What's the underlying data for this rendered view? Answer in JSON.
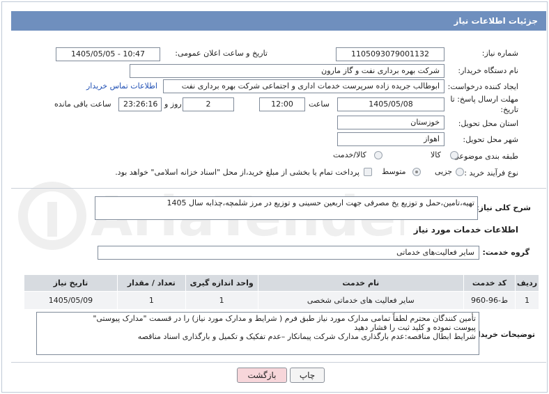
{
  "header": {
    "title": "جزئیات اطلاعات نیاز"
  },
  "fields": {
    "need_number_label": "شماره نیاز:",
    "need_number": "1105093079001132",
    "announce_label": "تاریخ و ساعت اعلان عمومی:",
    "announce_value": "1405/05/05 - 10:47",
    "buyer_org_label": "نام دستگاه خریدار:",
    "buyer_org": "شرکت بهره برداری نفت و گاز مارون",
    "creator_label": "ایجاد کننده درخواست:",
    "creator": "ابوطالب جریده زاده سرپرست خدمات اداری و اجتماعی شرکت بهره برداری نفت",
    "contact_link": "اطلاعات تماس خریدار",
    "deadline_label_1": "مهلت ارسال پاسخ: تا",
    "deadline_label_2": "تاریخ:",
    "deadline_date": "1405/05/08",
    "time_label": "ساعت",
    "deadline_time": "12:00",
    "days_value": "2",
    "days_label": "روز و",
    "remaining_time": "23:26:16",
    "remaining_label": "ساعت باقی مانده",
    "province_label": "استان محل تحویل:",
    "province": "خوزستان",
    "city_label": "شهر محل تحویل:",
    "city": "اهواز",
    "category_label": "طبقه بندی موضوعی:",
    "category_options": [
      "کالا",
      "کالا/خدمت"
    ],
    "process_label": "نوع فرآیند خرید :",
    "process_options": [
      "جزیی",
      "متوسط"
    ],
    "payment_note": "پرداخت تمام یا بخشی از مبلغ خرید،از محل \"اسناد خزانه اسلامی\" خواهد بود."
  },
  "description": {
    "label": "شرح کلی نیاز:",
    "text": "تهیه،تامین،حمل و توزیع یخ مصرفی جهت اربعین حسینی و توزیع در مرز شلمچه،چذابه  سال 1405"
  },
  "services": {
    "section_title": "اطلاعات خدمات مورد نیاز",
    "group_label": "گروه خدمت:",
    "group_value": "سایر فعالیت‌های خدماتی",
    "columns": [
      "ردیف",
      "کد خدمت",
      "نام خدمت",
      "واحد اندازه گیری",
      "تعداد / مقدار",
      "تاریخ نیاز"
    ],
    "rows": [
      [
        "1",
        "ط-96-960",
        "سایر فعالیت های خدماتی شخصی",
        "1",
        "1",
        "1405/05/09"
      ]
    ]
  },
  "buyer_notes": {
    "label": "توضیحات خریدار:",
    "lines": [
      "تأمین کنندگان محترم لطفاً تمامی مدارک مورد نیاز طبق فرم ( شرایط و مدارک مورد نیاز) را در قسمت \"مدارک پیوستی\"",
      "پیوست نموده و کلید ثبت را فشار دهید",
      "شرایط ابطال مناقصه:عدم بارگذاری مدارک شرکت پیمانکار –عدم تفکیک و تکمیل و بارگذاری  اسناد مناقصه"
    ]
  },
  "buttons": {
    "print": "چاپ",
    "back": "بازگشت"
  },
  "watermark": {
    "text": "AriaTender.net"
  },
  "colors": {
    "header": "#6f8fbe",
    "back_button": "#f7d6da",
    "link": "#1f4fb4"
  }
}
